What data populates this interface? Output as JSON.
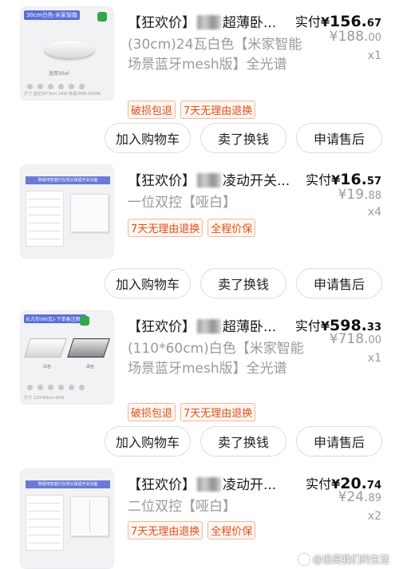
{
  "orders": [
    {
      "title_prefix": "【狂欢价】",
      "title_suffix": "超薄卧...",
      "spec": "(30cm)24瓦白色【米家智能场景蓝牙mesh版】全光谱",
      "tags": [
        "破损包退",
        "7天无理由退换"
      ],
      "paid_label": "实付",
      "paid_currency": "¥",
      "paid_int": "156.",
      "paid_dec": "67",
      "orig_currency": "¥",
      "orig_int": "188.",
      "orig_dec": "00",
      "qty": "x1",
      "image_tag": "30cm白色-米家智能",
      "image_caption": "适用30㎡",
      "image_footer": "尺寸 直径30*3cm  24W  色温3000-6500K"
    },
    {
      "title_prefix": "【狂欢价】",
      "title_suffix": "凌动开关...",
      "spec": "一位双控【哑白】",
      "tags": [
        "7天无理由退换",
        "全程价保"
      ],
      "paid_label": "实付",
      "paid_currency": "¥",
      "paid_int": "16.",
      "paid_dec": "57",
      "orig_currency": "¥",
      "orig_int": "19.",
      "orig_dec": "88",
      "qty": "x4",
      "image_tag": "既保持智能灯在线又保留开关功能"
    },
    {
      "title_prefix": "【狂欢价】",
      "title_suffix": "超薄卧...",
      "spec": "(110*60cm)白色【米家智能场景蓝牙mesh版】全光谱",
      "tags": [
        "破损包退",
        "7天无理由退换"
      ],
      "paid_label": "实付",
      "paid_currency": "¥",
      "paid_int": "598.",
      "paid_dec": "33",
      "orig_currency": "¥",
      "orig_int": "718.",
      "orig_dec": "00",
      "qty": "x1",
      "image_tag": "长方形(60瓦)-下单备注颜色",
      "image_caption_white": "白色",
      "image_caption_black": "黑色",
      "image_footer": "尺寸 110*60cm  60W"
    },
    {
      "title_prefix": "【狂欢价】",
      "title_suffix": "凌动开...",
      "spec": "二位双控【哑白】",
      "tags": [
        "7天无理由退换",
        "全程价保"
      ],
      "paid_label": "实付",
      "paid_currency": "¥",
      "paid_int": "20.",
      "paid_dec": "74",
      "orig_currency": "¥",
      "orig_int": "24.",
      "orig_dec": "89",
      "qty": "x2",
      "image_tag": "既保持智能灯在线又保留开关功能"
    }
  ],
  "buttons": {
    "add_cart": "加入购物车",
    "resell": "卖了换钱",
    "after_sale": "申请售后"
  },
  "watermark": "@追属我们的生活"
}
